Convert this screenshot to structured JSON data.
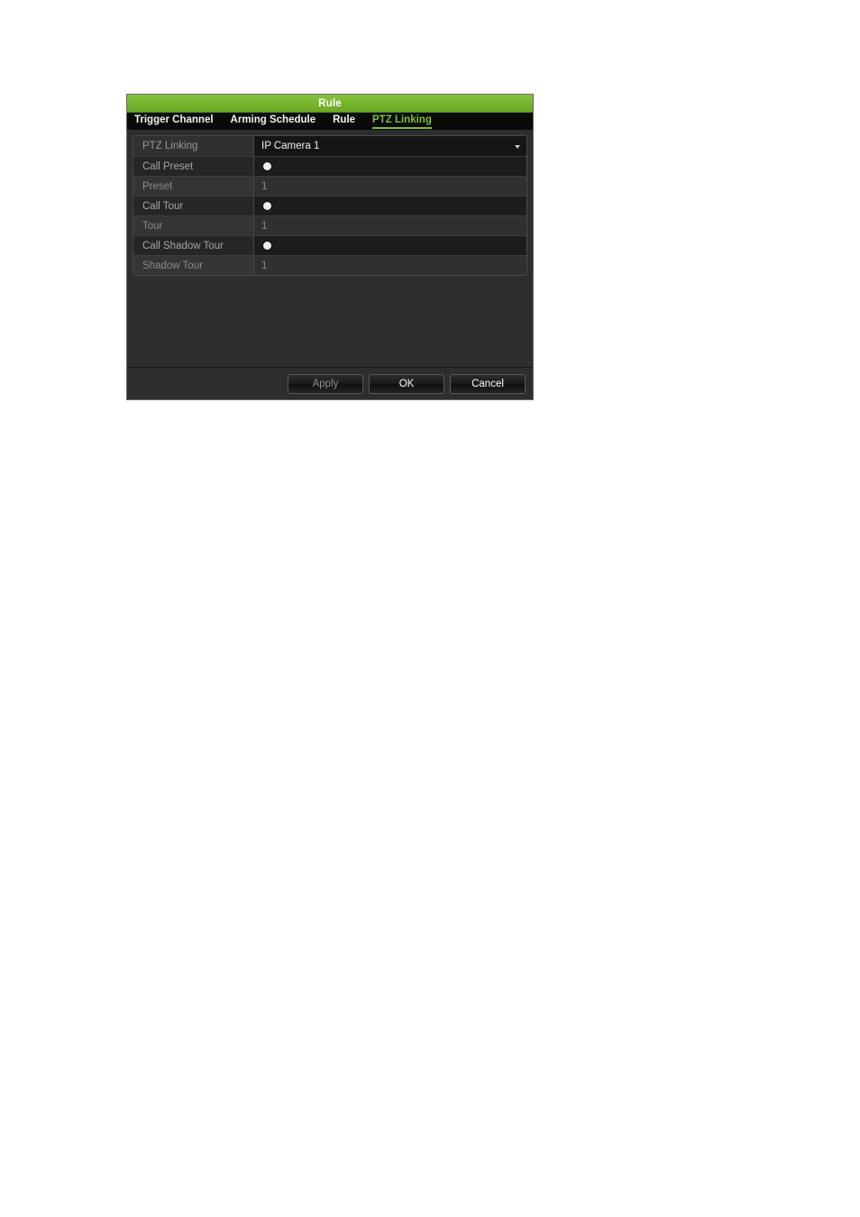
{
  "dialog": {
    "title": "Rule",
    "accent_color": "#76b52c",
    "tabs": [
      {
        "label": "Trigger Channel",
        "active": false
      },
      {
        "label": "Arming Schedule",
        "active": false
      },
      {
        "label": "Rule",
        "active": false
      },
      {
        "label": "PTZ Linking",
        "active": true
      }
    ],
    "rows": [
      {
        "label": "PTZ Linking",
        "value": "IP Camera 1",
        "type": "dropdown"
      },
      {
        "label": "Call Preset",
        "value": "",
        "type": "radio"
      },
      {
        "label": "Preset",
        "value": "1",
        "type": "text"
      },
      {
        "label": "Call Tour",
        "value": "",
        "type": "radio"
      },
      {
        "label": "Tour",
        "value": "1",
        "type": "text"
      },
      {
        "label": "Call Shadow Tour",
        "value": "",
        "type": "radio"
      },
      {
        "label": "Shadow Tour",
        "value": "1",
        "type": "text"
      }
    ],
    "buttons": {
      "apply": "Apply",
      "ok": "OK",
      "cancel": "Cancel"
    }
  }
}
